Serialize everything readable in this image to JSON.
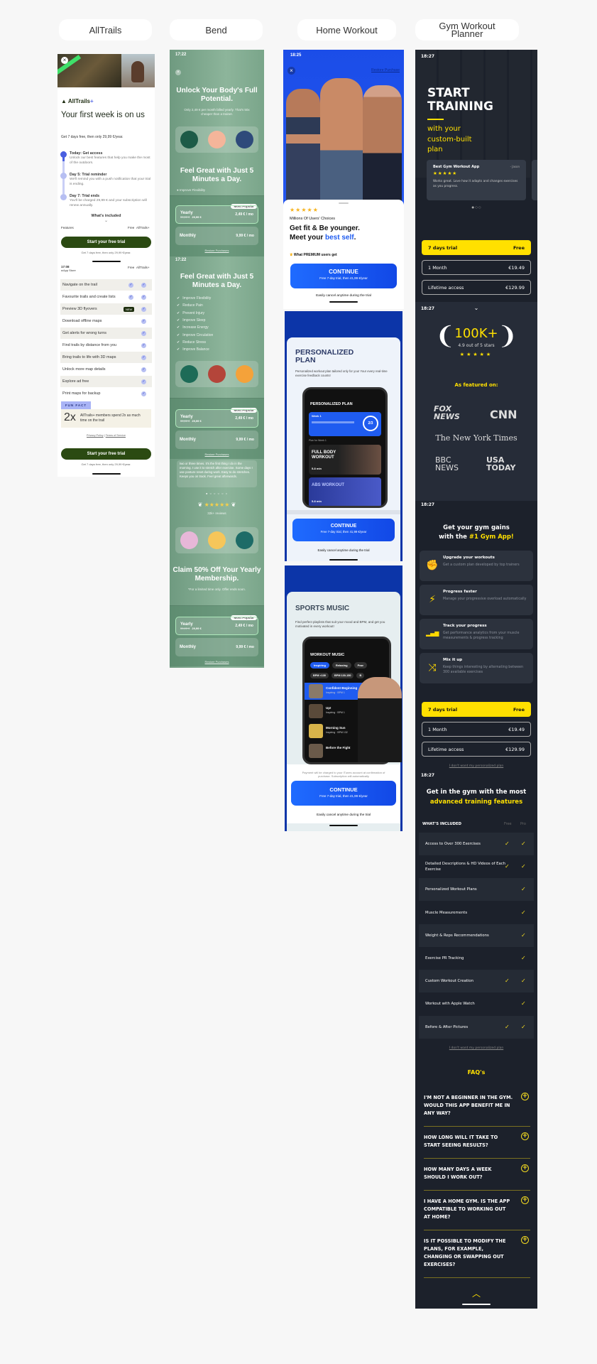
{
  "labels": [
    "AllTrails",
    "Bend",
    "Home Workout",
    "Gym Workout Planner"
  ],
  "alltrails": {
    "brand": "AllTrails",
    "brand_plus": "+",
    "title": "Your first week is on us",
    "subtitle": "Get 7 days free, then only 29,99 €/year.",
    "timeline": [
      {
        "title": "Today: Get access",
        "text": "Unlock our best features that help you make the most of the outdoors."
      },
      {
        "title": "Day 5: Trial reminder",
        "text": "We'll remind you with a push notification that your trial is ending."
      },
      {
        "title": "Day 7: Trial ends",
        "text": "You'll be charged 29,99 € and your subscription will renew annually."
      }
    ],
    "whats_included": "What's included",
    "columns": [
      "Features",
      "Free",
      "AllTrails+"
    ],
    "cta": "Start your free trial",
    "cta_note": "Get 7 days free, then only 29,99 €/year.",
    "time2": "17:08",
    "app_store": "◂ App Store",
    "features": [
      {
        "label": "Navigate on the trail",
        "free": "check"
      },
      {
        "label": "Favourite trails and create lists",
        "free": "check"
      },
      {
        "label": "Preview 3D flyovers",
        "free": "NEW"
      },
      {
        "label": "Download offline maps",
        "free": ""
      },
      {
        "label": "Get alerts for wrong turns",
        "free": ""
      },
      {
        "label": "Find trails by distance from you",
        "free": ""
      },
      {
        "label": "Bring trails to life with 3D maps",
        "free": ""
      },
      {
        "label": "Unlock more map details",
        "free": ""
      },
      {
        "label": "Explore ad free",
        "free": ""
      },
      {
        "label": "Print maps for backup",
        "free": ""
      }
    ],
    "fun_fact_label": "FUN FACT",
    "fun_fact_big": "2x",
    "fun_fact_text": "AllTrails+ members spend 2x as much time on the trail",
    "privacy": "Privacy Policy",
    "separator": " | ",
    "terms": "Terms of Service"
  },
  "bend": {
    "time": "17:22",
    "title": "Unlock Your Body's Full Potential.",
    "subtitle": "Only 2,49 € per month billed yearly. That's 50x cheaper than a trainer.",
    "heading": "Feel Great with Just 5 Minutes a Day.",
    "benefits": [
      "Improve Flexibility",
      "Reduce Pain",
      "Prevent Injury",
      "Improve Sleep",
      "Increase Energy",
      "Improve Circulation",
      "Reduce Stress",
      "Improve Balance"
    ],
    "review_text": "two or three times. It's the first thing I do in the morning. I use it to stretch after exercise. Some days I use posture reset during work. Easy to do stretches. Keeps you on track. Feel great afterwards.",
    "stars": "★★★★★",
    "reviews": "32k+ reviews",
    "claim_title": "Claim 50% Off Your Yearly Membership.",
    "claim_note": "*For a limited time only. Offer ends soon.",
    "pricing": {
      "badge": "Most Popular",
      "yearly": "Yearly",
      "old_price": "59,99 €",
      "new_price": "29,99 €",
      "yearly_price": "2,49 € / mo",
      "monthly": "Monthly",
      "monthly_price": "9,99 € / mo",
      "restore": "Restore Purchases"
    }
  },
  "home": {
    "time": "18:25",
    "restore": "Restore Purchase",
    "stars": "★★★★★",
    "choices": "Millions Of Users' Choices",
    "headline1": "Get fit & Be younger.",
    "headline2a": "Meet your ",
    "headline2b": "best self",
    "headline2c": ".",
    "premium": "What PREMIUM users get",
    "continue": "CONTINUE",
    "trial": "Free 7-day trial, then 41,99 €/year",
    "cancel": "Easily cancel anytime during the trial",
    "plan": {
      "title": "PERSONALIZED PLAN",
      "desc": "Personalized workout plan tailored only for you! Your every real-time exercise feedback counts!",
      "phone_title": "PERSONALIZED PLAN",
      "week": "Week 1",
      "progress": "2/3",
      "days": [
        "19",
        "20",
        "21",
        "22",
        "24",
        "25",
        "26"
      ],
      "plan_for": "Plan for Week 1",
      "workouts": [
        {
          "name": "FULL BODY WORKOUT",
          "dur": "5-8 min"
        },
        {
          "name": "ABS WORKOUT",
          "dur": "5-8 min"
        }
      ]
    },
    "music": {
      "title": "SPORTS MUSIC",
      "desc": "Find perfect playlists that suit your mood and BPM, and get you motivated in every workout!",
      "phone_title": "WORKOUT MUSIC",
      "chips": [
        "Inspiring",
        "Relaxing",
        "Pow"
      ],
      "bpm": [
        "BPM <130",
        "BPM 130-150",
        "B"
      ],
      "tracks": [
        {
          "name": "Confident Beginning",
          "meta": "Inspiring · BPM 1"
        },
        {
          "name": "Up!",
          "meta": "Inspiring · BPM 1"
        },
        {
          "name": "Morning Sun",
          "meta": "Inspiring · BPM 132"
        },
        {
          "name": "Before the Fight",
          "meta": ""
        }
      ],
      "payment": "Payment will be charged to your iTunes account at confirmation of purchase. Subscription will automatically"
    }
  },
  "gym": {
    "time": "18:27",
    "title1": "START",
    "title2": "TRAINING",
    "sub": "with your custom-built plan",
    "review": {
      "title": "Best Gym Workout App",
      "author": "- Jason",
      "stars": "★★★★★",
      "text": "Works great. Love how it adapts and changes exercises as you progress."
    },
    "plans": [
      {
        "label": "7 days trial",
        "price": "Free"
      },
      {
        "label": "1 Month",
        "price": "€19.49"
      },
      {
        "label": "Lifetime access",
        "price": "€129.99"
      }
    ],
    "rating": "100K+",
    "rating_sub": "4.9 out of 5 stars",
    "featured": "As featured on:",
    "logos": [
      "FOX NEWS",
      "CNN",
      "The New York Times",
      "BBC NEWS",
      "USA TODAY"
    ],
    "gains1": "Get your gym gains",
    "gains2a": "with the ",
    "gains2b": "#1 Gym App!",
    "features": [
      {
        "icon": "muscle-icon",
        "title": "Upgrade your workouts",
        "text": "Get a custom plan developed by top trainers"
      },
      {
        "icon": "lightning-icon",
        "title": "Progress faster",
        "text": "Manage your progressive overload automatically"
      },
      {
        "icon": "chart-bars-icon",
        "title": "Track your progress",
        "text": "Get performance analytics from your muscle measurements & progress tracking"
      },
      {
        "icon": "shuffle-icon",
        "title": "Mix it up",
        "text": "Keep things interesting by alternating between 300 available exercises"
      }
    ],
    "decline": "I don't want my personalized plan",
    "adv1": "Get in the gym with the most",
    "adv2": "advanced training features",
    "included": "WHAT'S INCLUDED",
    "free": "Free",
    "pro": "Pro",
    "table": [
      {
        "label": "Access to Over 300 Exercises",
        "free": true
      },
      {
        "label": "Detailed Descriptions & HD Videos of Each Exercise",
        "free": true
      },
      {
        "label": "Personalized Workout Plans",
        "free": false
      },
      {
        "label": "Muscle Measurements",
        "free": false
      },
      {
        "label": "Weight & Reps Recommendations",
        "free": false
      },
      {
        "label": "Exercise PR Tracking",
        "free": false
      },
      {
        "label": "Custom Workout Creation",
        "free": true
      },
      {
        "label": "Workout with Apple Watch",
        "free": false
      },
      {
        "label": "Before & After Pictures",
        "free": true
      }
    ],
    "faq_title": "FAQ's",
    "faqs": [
      "I'M NOT A BEGINNER IN THE GYM. WOULD THIS APP BENEFIT ME IN ANY WAY?",
      "HOW LONG WILL IT TAKE TO START SEEING RESULTS?",
      "HOW MANY DAYS A WEEK SHOULD I WORK OUT?",
      "I HAVE A HOME GYM. IS THE APP COMPATIBLE TO WORKING OUT AT HOME?",
      "IS IT POSSIBLE TO MODIFY THE PLANS, FOR EXAMPLE, CHANGING OR SWAPPING OUT EXERCISES?"
    ],
    "accent": "#ffe000"
  }
}
